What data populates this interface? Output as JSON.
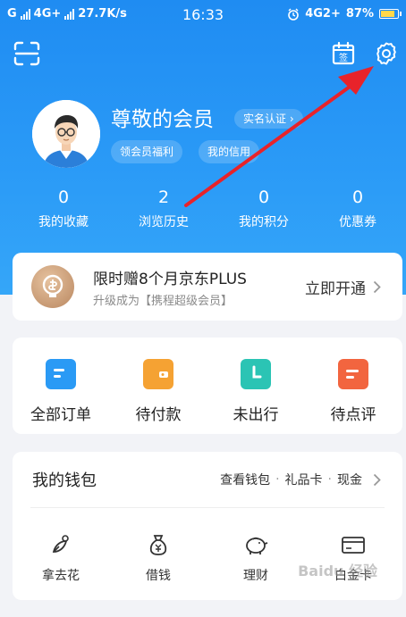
{
  "status_bar": {
    "carrier_left": "G",
    "network_left": "4G+",
    "speed": "27.7K/s",
    "time": "16:33",
    "network_right": "4G2+",
    "battery_percent": "87%",
    "battery_level": 0.87
  },
  "header": {
    "scan_icon": "scan-icon",
    "signin_icon_label": "签",
    "settings_icon": "gear-icon"
  },
  "profile": {
    "name": "尊敬的会员",
    "verify_label": "实名认证",
    "benefits_label": "领会员福利",
    "credit_label": "我的信用"
  },
  "stats": [
    {
      "value": "0",
      "label": "我的收藏"
    },
    {
      "value": "2",
      "label": "浏览历史"
    },
    {
      "value": "0",
      "label": "我的积分"
    },
    {
      "value": "0",
      "label": "优惠券"
    }
  ],
  "plus_banner": {
    "title": "限时赠8个月京东PLUS",
    "subtitle": "升级成为【携程超级会员】",
    "cta": "立即开通"
  },
  "orders": [
    {
      "label": "全部订单",
      "icon": "all-orders-icon",
      "color": "#2a9af5"
    },
    {
      "label": "待付款",
      "icon": "wallet-icon",
      "color": "#f5a233"
    },
    {
      "label": "未出行",
      "icon": "clock-icon",
      "color": "#2bc4b4"
    },
    {
      "label": "待点评",
      "icon": "comment-icon",
      "color": "#f2653f"
    }
  ],
  "wallet": {
    "title": "我的钱包",
    "links": [
      "查看钱包",
      "礼品卡",
      "现金"
    ],
    "items": [
      {
        "label": "拿去花",
        "icon": "flower-icon"
      },
      {
        "label": "借钱",
        "icon": "money-bag-icon"
      },
      {
        "label": "理财",
        "icon": "piggy-bank-icon"
      },
      {
        "label": "白金卡",
        "icon": "card-icon"
      }
    ]
  },
  "watermark": "Baidu 经验",
  "colors": {
    "hero_blue": "#1f8cf2",
    "arrow_red": "#e8232a"
  }
}
